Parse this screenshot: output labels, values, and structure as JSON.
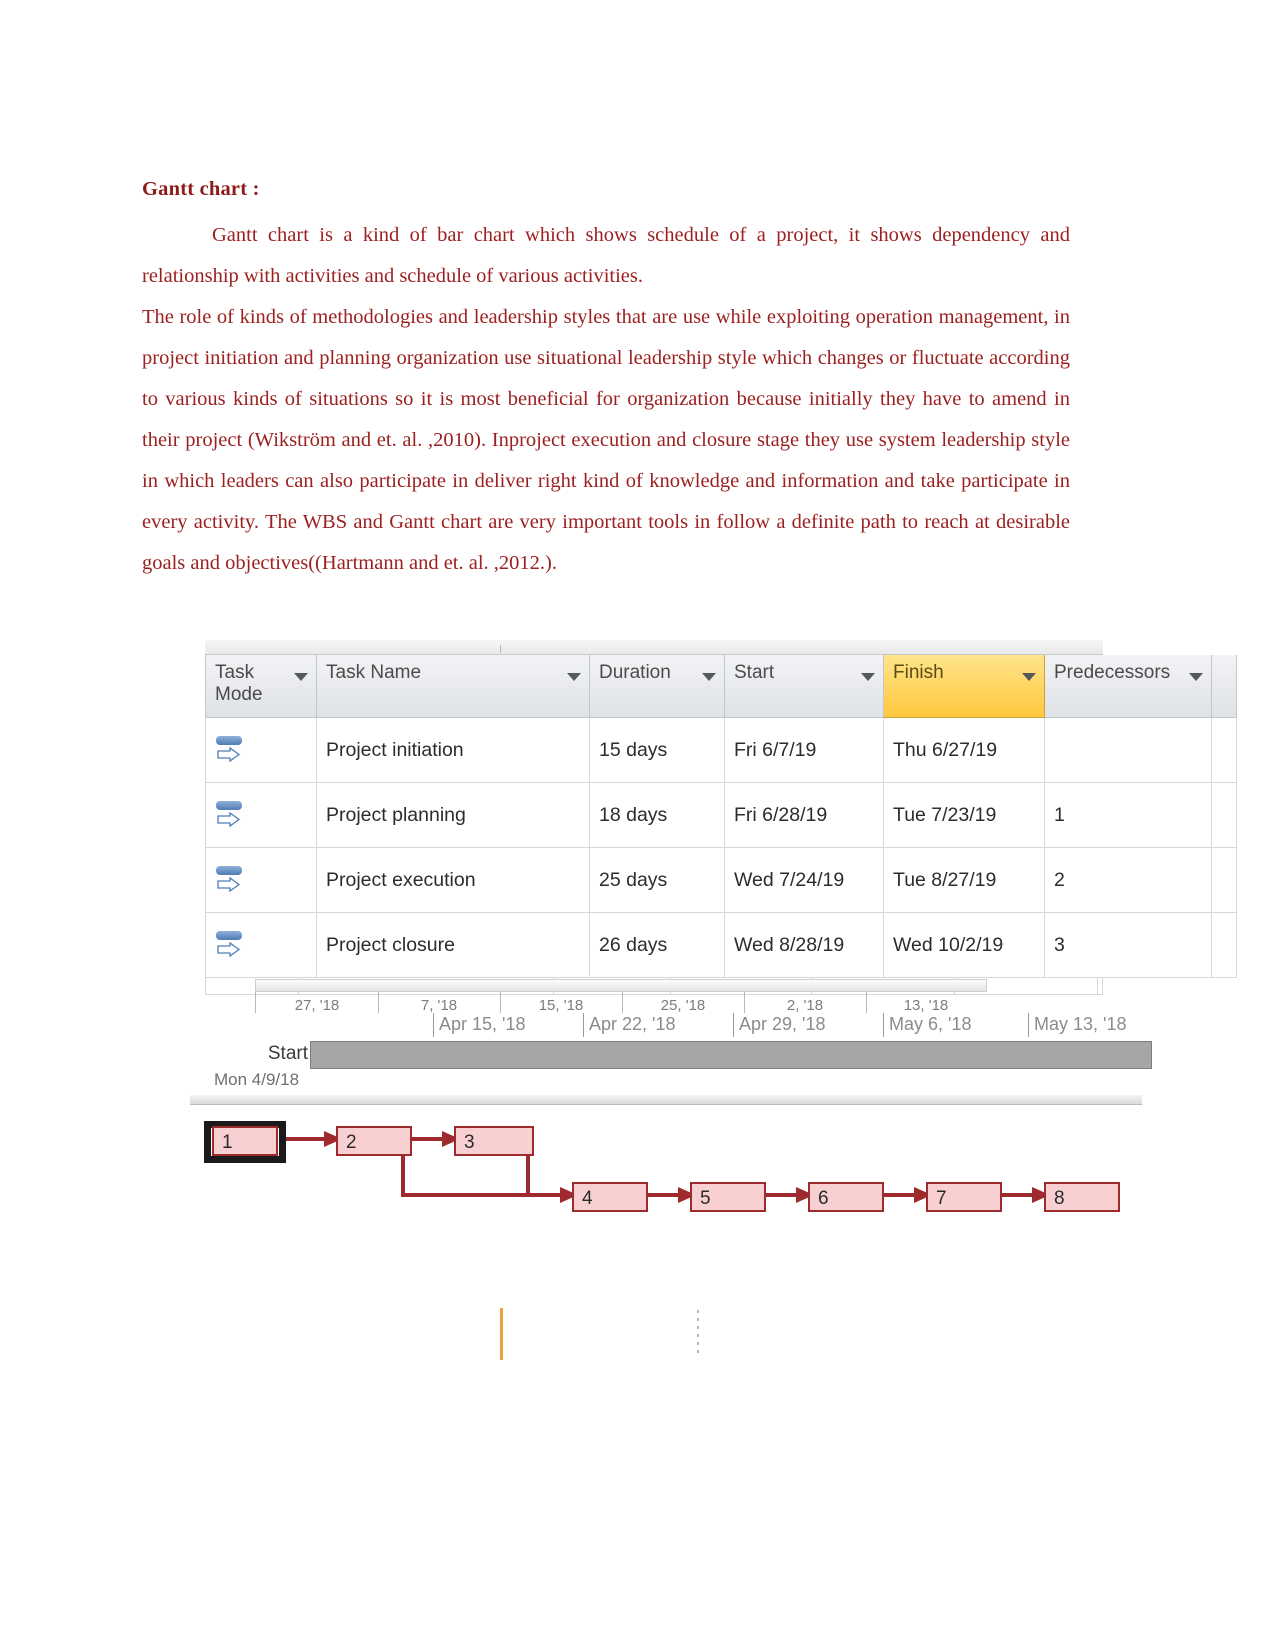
{
  "document": {
    "heading": "Gantt chart :",
    "paragraphs": [
      "Gantt chart is a kind of bar chart which shows schedule of a project, it shows dependency and relationship with activities and schedule of various activities.",
      "The role of kinds of methodologies and leadership styles that are use while exploiting operation management, in project initiation and planning organization use situational leadership style which changes or fluctuate according to various kinds of situations so it is most beneficial for organization because initially they have to amend in their project (Wikström and et. al. ,2010). Inproject execution and closure stage they use system leadership style in which leaders can also participate in deliver right kind of knowledge and information and take participate in every activity. The WBS and Gantt chart are very important tools in follow a definite path to reach at desirable goals and objectives((Hartmann  and et. al. ,2012.)."
    ],
    "text_color": "#9c2020",
    "heading_color": "#8d1b1b"
  },
  "project_table": {
    "columns": [
      {
        "label": "Task Mode",
        "line1": "Task",
        "line2": "Mode",
        "highlighted": false
      },
      {
        "label": "Task Name",
        "line1": "Task Name",
        "line2": "",
        "highlighted": false
      },
      {
        "label": "Duration",
        "line1": "Duration",
        "line2": "",
        "highlighted": false
      },
      {
        "label": "Start",
        "line1": "Start",
        "line2": "",
        "highlighted": false
      },
      {
        "label": "Finish",
        "line1": "Finish",
        "line2": "",
        "highlighted": true
      },
      {
        "label": "Predecessors",
        "line1": "Predecessors",
        "line2": "",
        "highlighted": false
      }
    ],
    "highlight_color": "#ffc83d",
    "rows": [
      {
        "mode_icon": "auto-schedule-icon",
        "name": "Project initiation",
        "duration": "15 days",
        "start": "Fri 6/7/19",
        "finish": "Thu 6/27/19",
        "predecessors": ""
      },
      {
        "mode_icon": "auto-schedule-icon",
        "name": "Project planning",
        "duration": "18 days",
        "start": "Fri 6/28/19",
        "finish": "Tue 7/23/19",
        "predecessors": "1"
      },
      {
        "mode_icon": "auto-schedule-icon",
        "name": "Project execution",
        "duration": "25 days",
        "start": "Wed 7/24/19",
        "finish": "Tue 8/27/19",
        "predecessors": "2"
      },
      {
        "mode_icon": "auto-schedule-icon",
        "name": "Project closure",
        "duration": "26 days",
        "start": "Wed 8/28/19",
        "finish": "Wed 10/2/19",
        "predecessors": "3"
      }
    ]
  },
  "timeline": {
    "minor_ticks": [
      "27, '18",
      "7, '18",
      "15, '18",
      "25, '18",
      "2, '18",
      "13, '18"
    ],
    "major_labels": [
      "Apr 15, '18",
      "Apr 22, '18",
      "Apr 29, '18",
      "May 6, '18",
      "May 13, '18"
    ],
    "start_label": "Start",
    "start_date": "Mon 4/9/18",
    "bar_color": "#a6a6a6"
  },
  "network_diagram": {
    "node_fill": "#f8d0d2",
    "node_border": "#9e2a2e",
    "connector_color": "#9e2a2e",
    "top_row": [
      {
        "id": "1",
        "selected": true
      },
      {
        "id": "2",
        "selected": false
      },
      {
        "id": "3",
        "selected": false
      }
    ],
    "bottom_row": [
      {
        "id": "4",
        "selected": false
      },
      {
        "id": "5",
        "selected": false
      },
      {
        "id": "6",
        "selected": false
      },
      {
        "id": "7",
        "selected": false
      },
      {
        "id": "8",
        "selected": false
      }
    ]
  }
}
